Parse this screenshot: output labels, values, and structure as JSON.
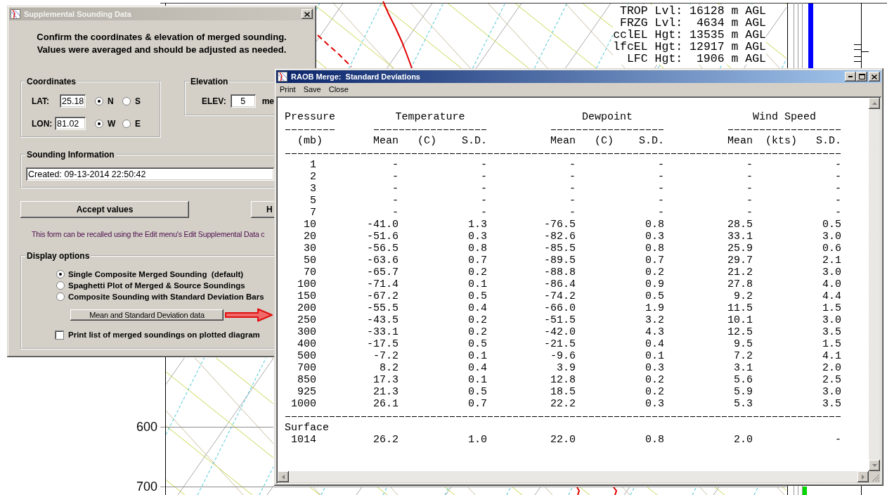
{
  "background": {
    "axis_labels": [
      "600",
      "700"
    ],
    "levels": [
      {
        "label": "TROP Lvl:",
        "value": "16128 m AGL"
      },
      {
        "label": "FRZG Lvl:",
        "value": "4634 m AGL"
      },
      {
        "label": "cclEL Hgt:",
        "value": "13535 m AGL"
      },
      {
        "label": "lfcEL Hgt:",
        "value": "12917 m AGL"
      },
      {
        "label": "LFC Hgt:",
        "value": "1906 m AGL"
      }
    ]
  },
  "dialog": {
    "title": "Supplemental Sounding Data",
    "active": false,
    "instructions": [
      "Confirm the coordinates & elevation of merged sounding.",
      "Values were averaged and should be adjusted as needed."
    ],
    "coordinates": {
      "label": "Coordinates",
      "fields": [
        {
          "label": "LAT:",
          "value": "25.18",
          "options": [
            {
              "label": "N",
              "selected": true
            },
            {
              "label": "S",
              "selected": false
            }
          ]
        },
        {
          "label": "LON:",
          "value": "81.02",
          "options": [
            {
              "label": "W",
              "selected": true
            },
            {
              "label": "E",
              "selected": false
            }
          ]
        }
      ]
    },
    "elevation": {
      "label": "Elevation",
      "field_label": "ELEV:",
      "value": "5",
      "unit": "me"
    },
    "sounding_information": {
      "label": "Sounding Information",
      "value": "Created: 09-13-2014 22:50:42"
    },
    "buttons": [
      "Accept values",
      "H"
    ],
    "note": "This form can be recalled using the Edit menu's Edit Supplemental Data c",
    "display_options": {
      "label": "Display options",
      "options": [
        {
          "label": "Single Composite Merged Sounding  (default)",
          "selected": true
        },
        {
          "label": "Spaghetti Plot of Merged & Source Soundings",
          "selected": false
        },
        {
          "label": "Composite Sounding with Standard Deviation Bars",
          "selected": false
        }
      ],
      "data_button": "Mean and Standard Deviation data",
      "print_list": {
        "label": "Print list of merged soundings on plotted diagram",
        "checked": false
      }
    }
  },
  "report_window": {
    "title": "RAOB Merge:  Standard Deviations",
    "active": true,
    "menu": [
      "Print",
      "Save",
      "Close"
    ],
    "table": {
      "groups": [
        "Pressure",
        "Temperature",
        "Dewpoint",
        "Wind Speed"
      ],
      "subheaders": [
        "(mb)",
        "Mean",
        "(C)",
        "S.D.",
        "Mean",
        "(C)",
        "S.D.",
        "Mean",
        "(kts)",
        "S.D."
      ],
      "rows": [
        {
          "cells": [
            "1",
            "-",
            "-",
            "-",
            "-",
            "-",
            "-"
          ]
        },
        {
          "cells": [
            "2",
            "-",
            "-",
            "-",
            "-",
            "-",
            "-"
          ]
        },
        {
          "cells": [
            "3",
            "-",
            "-",
            "-",
            "-",
            "-",
            "-"
          ]
        },
        {
          "cells": [
            "5",
            "-",
            "-",
            "-",
            "-",
            "-",
            "-"
          ]
        },
        {
          "cells": [
            "7",
            "-",
            "-",
            "-",
            "-",
            "-",
            "-"
          ]
        },
        {
          "cells": [
            "10",
            "-41.0",
            "1.3",
            "-76.5",
            "0.8",
            "28.5",
            "0.5"
          ]
        },
        {
          "cells": [
            "20",
            "-51.6",
            "0.3",
            "-82.6",
            "0.3",
            "33.1",
            "3.0"
          ]
        },
        {
          "cells": [
            "30",
            "-56.5",
            "0.8",
            "-85.5",
            "0.8",
            "25.9",
            "0.6"
          ]
        },
        {
          "cells": [
            "50",
            "-63.6",
            "0.7",
            "-89.5",
            "0.7",
            "29.7",
            "2.1"
          ]
        },
        {
          "cells": [
            "70",
            "-65.7",
            "0.2",
            "-88.8",
            "0.2",
            "21.2",
            "3.0"
          ]
        },
        {
          "cells": [
            "100",
            "-71.4",
            "0.1",
            "-86.4",
            "0.9",
            "27.8",
            "4.0"
          ]
        },
        {
          "cells": [
            "150",
            "-67.2",
            "0.5",
            "-74.2",
            "0.5",
            "9.2",
            "4.4"
          ]
        },
        {
          "cells": [
            "200",
            "-55.5",
            "0.4",
            "-66.0",
            "1.9",
            "11.5",
            "1.5"
          ]
        },
        {
          "cells": [
            "250",
            "-43.5",
            "0.2",
            "-51.5",
            "3.2",
            "10.1",
            "3.0"
          ]
        },
        {
          "cells": [
            "300",
            "-33.1",
            "0.2",
            "-42.0",
            "4.3",
            "12.5",
            "3.5"
          ]
        },
        {
          "cells": [
            "400",
            "-17.5",
            "0.5",
            "-21.5",
            "0.4",
            "9.5",
            "1.5"
          ]
        },
        {
          "cells": [
            "500",
            "-7.2",
            "0.1",
            "-9.6",
            "0.1",
            "7.2",
            "4.1"
          ]
        },
        {
          "cells": [
            "700",
            "8.2",
            "0.4",
            "3.9",
            "0.3",
            "3.1",
            "2.0"
          ]
        },
        {
          "cells": [
            "850",
            "17.3",
            "0.1",
            "12.8",
            "0.2",
            "5.6",
            "2.5"
          ]
        },
        {
          "cells": [
            "925",
            "21.3",
            "0.5",
            "18.5",
            "0.2",
            "5.9",
            "3.0"
          ]
        },
        {
          "cells": [
            "1000",
            "26.1",
            "0.7",
            "22.2",
            "0.3",
            "5.3",
            "3.5"
          ]
        }
      ],
      "surface": {
        "label": "Surface",
        "cells": [
          "1014",
          "26.2",
          "1.0",
          "22.0",
          "0.8",
          "2.0",
          "-"
        ]
      }
    }
  }
}
